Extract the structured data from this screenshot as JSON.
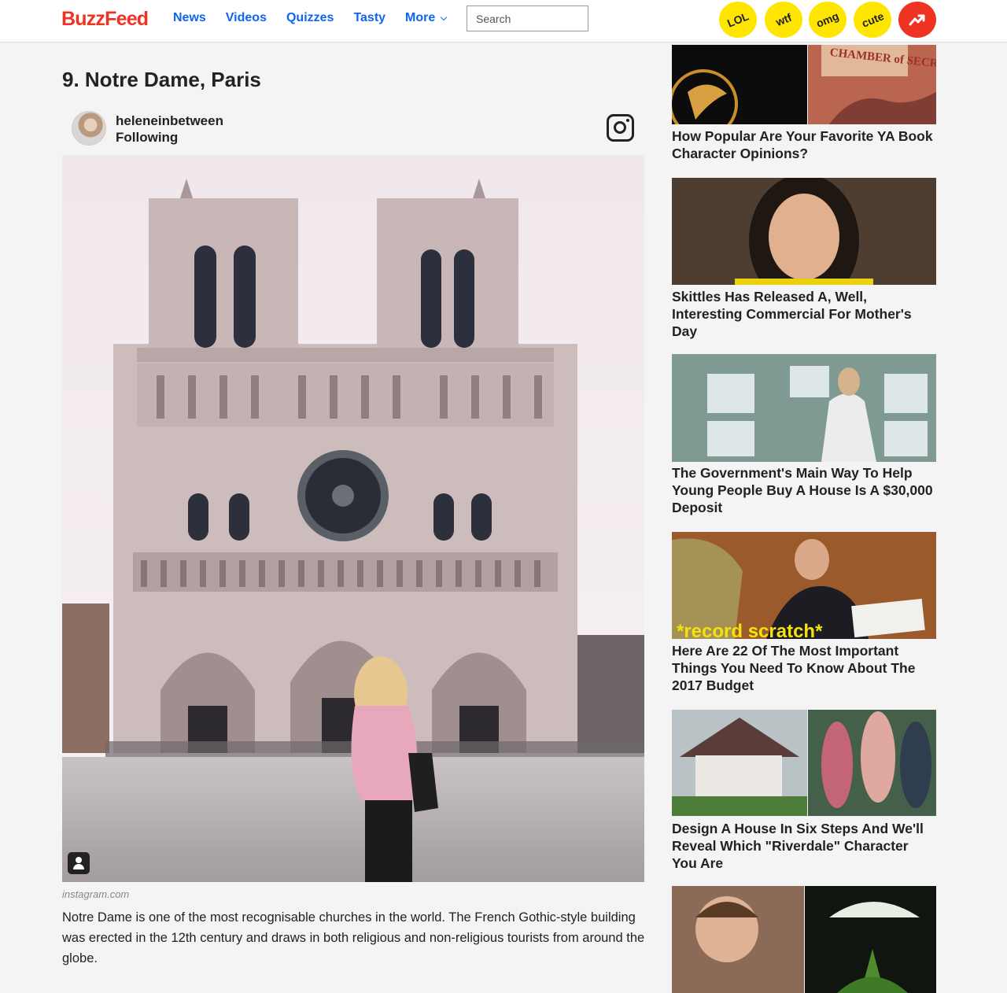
{
  "header": {
    "logo": "BuzzFeed",
    "nav": [
      "News",
      "Videos",
      "Quizzes",
      "Tasty",
      "More"
    ],
    "search_placeholder": "Search",
    "badges": [
      "LOL",
      "wtf",
      "omg",
      "cute"
    ]
  },
  "article": {
    "title": "9. Notre Dame, Paris",
    "author_name": "heleneinbetween",
    "author_status": "Following",
    "source": "instagram.com",
    "description": "Notre Dame is one of the most recognisable churches in the world. The French Gothic-style building was erected in the 12th century and draws in both religious and non-religious tourists from around the globe."
  },
  "sidebar": {
    "items": [
      {
        "title": "How Popular Are Your Favorite YA Book Character Opinions?",
        "image_text": "CHAMBER of SECRETS"
      },
      {
        "title": "Skittles Has Released A, Well, Interesting Commercial For Mother's Day"
      },
      {
        "title": "The Government's Main Way To Help Young People Buy A House Is A $30,000 Deposit"
      },
      {
        "title": "Here Are 22 Of The Most Important Things You Need To Know About The 2017 Budget",
        "image_text": "*record scratch*"
      },
      {
        "title": "Design A House In Six Steps And We'll Reveal Which \"Riverdale\" Character You Are"
      },
      {
        "title": ""
      }
    ]
  }
}
